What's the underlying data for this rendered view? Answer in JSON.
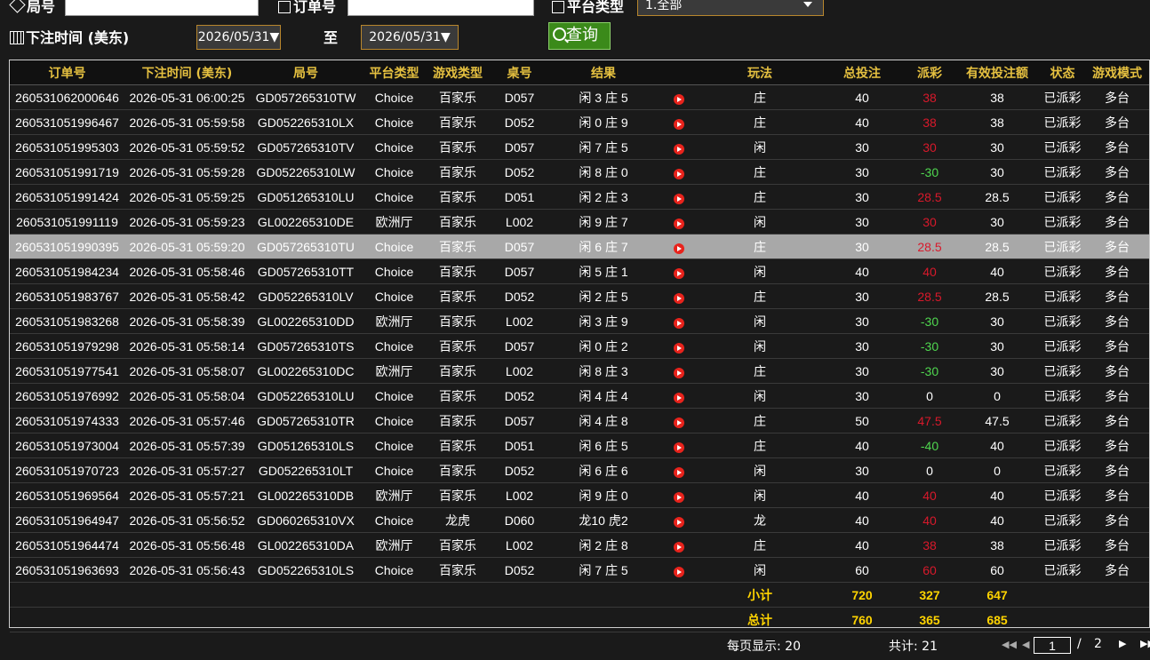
{
  "filters": {
    "round_label": "局号",
    "round_value": "",
    "order_label": "订单号",
    "order_value": "",
    "platform_label": "平台类型",
    "platform_value": "1.全部",
    "time_label": "下注时间 (美东)",
    "date_from": "2026/05/31▼",
    "to_label": "至",
    "date_to": "2026/05/31▼",
    "query_label": "查询"
  },
  "table": {
    "headers": [
      "订单号",
      "下注时间 (美东)",
      "局号",
      "平台类型",
      "游戏类型",
      "桌号",
      "结果",
      "",
      "玩法",
      "总投注",
      "派彩",
      "有效投注额",
      "状态",
      "游戏模式"
    ],
    "rows": [
      {
        "order": "260531062000646",
        "time": "2026-05-31 06:00:25",
        "round": "GD057265310TW",
        "platform": "Choice",
        "game": "百家乐",
        "table": "D057",
        "result": "闲 3 庄 5",
        "play": "庄",
        "bet": "40",
        "payout": "38",
        "pcls": "redv",
        "valid": "38",
        "status": "已派彩",
        "mode": "多台"
      },
      {
        "order": "260531051996467",
        "time": "2026-05-31 05:59:58",
        "round": "GD052265310LX",
        "platform": "Choice",
        "game": "百家乐",
        "table": "D052",
        "result": "闲 0 庄 9",
        "play": "庄",
        "bet": "40",
        "payout": "38",
        "pcls": "redv",
        "valid": "38",
        "status": "已派彩",
        "mode": "多台"
      },
      {
        "order": "260531051995303",
        "time": "2026-05-31 05:59:52",
        "round": "GD057265310TV",
        "platform": "Choice",
        "game": "百家乐",
        "table": "D057",
        "result": "闲 7 庄 5",
        "play": "闲",
        "bet": "30",
        "payout": "30",
        "pcls": "redv",
        "valid": "30",
        "status": "已派彩",
        "mode": "多台"
      },
      {
        "order": "260531051991719",
        "time": "2026-05-31 05:59:28",
        "round": "GD052265310LW",
        "platform": "Choice",
        "game": "百家乐",
        "table": "D052",
        "result": "闲 8 庄 0",
        "play": "庄",
        "bet": "30",
        "payout": "-30",
        "pcls": "neg",
        "valid": "30",
        "status": "已派彩",
        "mode": "多台"
      },
      {
        "order": "260531051991424",
        "time": "2026-05-31 05:59:25",
        "round": "GD051265310LU",
        "platform": "Choice",
        "game": "百家乐",
        "table": "D051",
        "result": "闲 2 庄 3",
        "play": "庄",
        "bet": "30",
        "payout": "28.5",
        "pcls": "redv",
        "valid": "28.5",
        "status": "已派彩",
        "mode": "多台"
      },
      {
        "order": "260531051991119",
        "time": "2026-05-31 05:59:23",
        "round": "GL002265310DE",
        "platform": "欧洲厅",
        "game": "百家乐",
        "table": "L002",
        "result": "闲 9 庄 7",
        "play": "闲",
        "bet": "30",
        "payout": "30",
        "pcls": "redv",
        "valid": "30",
        "status": "已派彩",
        "mode": "多台"
      },
      {
        "order": "260531051990395",
        "time": "2026-05-31 05:59:20",
        "round": "GD057265310TU",
        "platform": "Choice",
        "game": "百家乐",
        "table": "D057",
        "result": "闲 6 庄 7",
        "play": "庄",
        "bet": "30",
        "payout": "28.5",
        "pcls": "redv",
        "valid": "28.5",
        "status": "已派彩",
        "mode": "多台",
        "sel": true
      },
      {
        "order": "260531051984234",
        "time": "2026-05-31 05:58:46",
        "round": "GD057265310TT",
        "platform": "Choice",
        "game": "百家乐",
        "table": "D057",
        "result": "闲 5 庄 1",
        "play": "闲",
        "bet": "40",
        "payout": "40",
        "pcls": "redv",
        "valid": "40",
        "status": "已派彩",
        "mode": "多台"
      },
      {
        "order": "260531051983767",
        "time": "2026-05-31 05:58:42",
        "round": "GD052265310LV",
        "platform": "Choice",
        "game": "百家乐",
        "table": "D052",
        "result": "闲 2 庄 5",
        "play": "庄",
        "bet": "30",
        "payout": "28.5",
        "pcls": "redv",
        "valid": "28.5",
        "status": "已派彩",
        "mode": "多台"
      },
      {
        "order": "260531051983268",
        "time": "2026-05-31 05:58:39",
        "round": "GL002265310DD",
        "platform": "欧洲厅",
        "game": "百家乐",
        "table": "L002",
        "result": "闲 3 庄 9",
        "play": "闲",
        "bet": "30",
        "payout": "-30",
        "pcls": "neg",
        "valid": "30",
        "status": "已派彩",
        "mode": "多台"
      },
      {
        "order": "260531051979298",
        "time": "2026-05-31 05:58:14",
        "round": "GD057265310TS",
        "platform": "Choice",
        "game": "百家乐",
        "table": "D057",
        "result": "闲 0 庄 2",
        "play": "闲",
        "bet": "30",
        "payout": "-30",
        "pcls": "neg",
        "valid": "30",
        "status": "已派彩",
        "mode": "多台"
      },
      {
        "order": "260531051977541",
        "time": "2026-05-31 05:58:07",
        "round": "GL002265310DC",
        "platform": "欧洲厅",
        "game": "百家乐",
        "table": "L002",
        "result": "闲 8 庄 3",
        "play": "庄",
        "bet": "30",
        "payout": "-30",
        "pcls": "neg",
        "valid": "30",
        "status": "已派彩",
        "mode": "多台"
      },
      {
        "order": "260531051976992",
        "time": "2026-05-31 05:58:04",
        "round": "GD052265310LU",
        "platform": "Choice",
        "game": "百家乐",
        "table": "D052",
        "result": "闲 4 庄 4",
        "play": "闲",
        "bet": "30",
        "payout": "0",
        "pcls": "zero",
        "valid": "0",
        "status": "已派彩",
        "mode": "多台"
      },
      {
        "order": "260531051974333",
        "time": "2026-05-31 05:57:46",
        "round": "GD057265310TR",
        "platform": "Choice",
        "game": "百家乐",
        "table": "D057",
        "result": "闲 4 庄 8",
        "play": "庄",
        "bet": "50",
        "payout": "47.5",
        "pcls": "redv",
        "valid": "47.5",
        "status": "已派彩",
        "mode": "多台"
      },
      {
        "order": "260531051973004",
        "time": "2026-05-31 05:57:39",
        "round": "GD051265310LS",
        "platform": "Choice",
        "game": "百家乐",
        "table": "D051",
        "result": "闲 6 庄 5",
        "play": "庄",
        "bet": "40",
        "payout": "-40",
        "pcls": "neg",
        "valid": "40",
        "status": "已派彩",
        "mode": "多台"
      },
      {
        "order": "260531051970723",
        "time": "2026-05-31 05:57:27",
        "round": "GD052265310LT",
        "platform": "Choice",
        "game": "百家乐",
        "table": "D052",
        "result": "闲 6 庄 6",
        "play": "闲",
        "bet": "30",
        "payout": "0",
        "pcls": "zero",
        "valid": "0",
        "status": "已派彩",
        "mode": "多台"
      },
      {
        "order": "260531051969564",
        "time": "2026-05-31 05:57:21",
        "round": "GL002265310DB",
        "platform": "欧洲厅",
        "game": "百家乐",
        "table": "L002",
        "result": "闲 9 庄 0",
        "play": "闲",
        "bet": "40",
        "payout": "40",
        "pcls": "redv",
        "valid": "40",
        "status": "已派彩",
        "mode": "多台"
      },
      {
        "order": "260531051964947",
        "time": "2026-05-31 05:56:52",
        "round": "GD060265310VX",
        "platform": "Choice",
        "game": "龙虎",
        "table": "D060",
        "result": "龙10 虎2",
        "play": "龙",
        "bet": "40",
        "payout": "40",
        "pcls": "redv",
        "valid": "40",
        "status": "已派彩",
        "mode": "多台"
      },
      {
        "order": "260531051964474",
        "time": "2026-05-31 05:56:48",
        "round": "GL002265310DA",
        "platform": "欧洲厅",
        "game": "百家乐",
        "table": "L002",
        "result": "闲 2 庄 8",
        "play": "庄",
        "bet": "40",
        "payout": "38",
        "pcls": "redv",
        "valid": "38",
        "status": "已派彩",
        "mode": "多台"
      },
      {
        "order": "260531051963693",
        "time": "2026-05-31 05:56:43",
        "round": "GD052265310LS",
        "platform": "Choice",
        "game": "百家乐",
        "table": "D052",
        "result": "闲 7 庄 5",
        "play": "闲",
        "bet": "60",
        "payout": "60",
        "pcls": "redv",
        "valid": "60",
        "status": "已派彩",
        "mode": "多台"
      }
    ],
    "subtotal": {
      "label": "小计",
      "bet": "720",
      "payout": "327",
      "valid": "647"
    },
    "total": {
      "label": "总计",
      "bet": "760",
      "payout": "365",
      "valid": "685"
    }
  },
  "pager": {
    "per_page": "每页显示: 20",
    "total": "共计: 21",
    "page_input": "1",
    "sep": "/",
    "pages": "2"
  }
}
